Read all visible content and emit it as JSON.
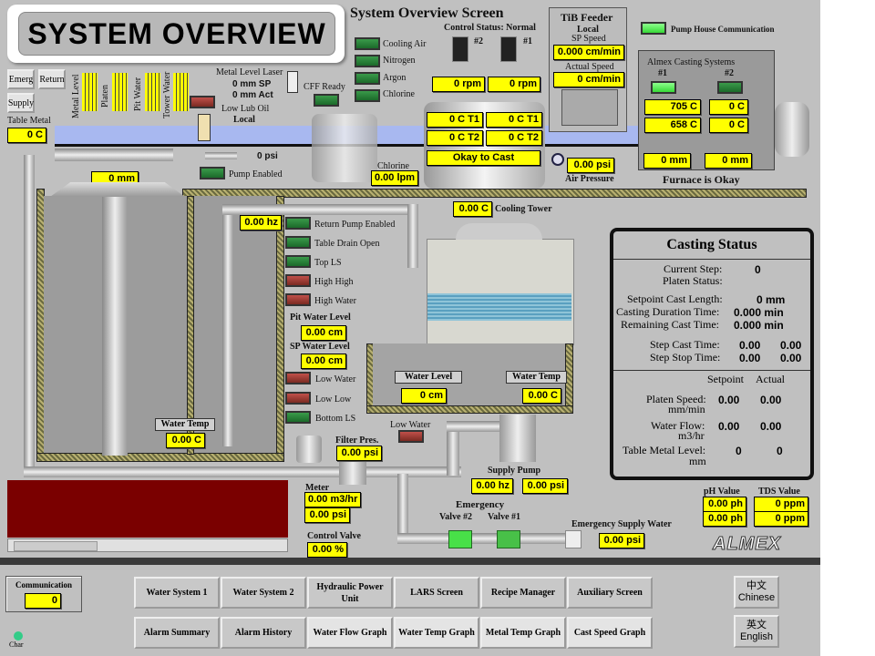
{
  "header": {
    "title": "SYSTEM OVERVIEW",
    "screen_title": "System Overview Screen",
    "control_status": "Control Status: Normal"
  },
  "left": {
    "emerg": "Emerg",
    "return": "Return",
    "supply": "Supply",
    "table_metal_label": "Table Metal",
    "table_metal": "0 C",
    "gauges": [
      "Metal Level",
      "Platen",
      "Pit Water",
      "Tower Water"
    ],
    "laser_title": "Metal Level Laser",
    "laser_sp": "0 mm SP",
    "laser_act": "0 mm Act",
    "low_lub_oil": "Low Lub Oil",
    "local": "Local",
    "psi": "0 psi",
    "pump_enabled": "Pump Enabled",
    "level_mm": "0 mm",
    "cff_ready": "CFF Ready",
    "chlorine_label": "Chlorine",
    "chlorine": "0.00 lpm"
  },
  "gases": [
    "Cooling Air",
    "Nitrogen",
    "Argon",
    "Chlorine"
  ],
  "degasser": {
    "m2": "#2",
    "m1": "#1",
    "rpm2": "0 rpm",
    "rpm1": "0 rpm",
    "t1a": "0 C T1",
    "t1b": "0 C T1",
    "t2a": "0 C T2",
    "t2b": "0 C T2",
    "okay": "Okay to Cast",
    "air_pressure": "0.00 psi",
    "air_pressure_label": "Air Pressure"
  },
  "tib": {
    "title": "TiB Feeder",
    "mode": "Local",
    "sp_label": "SP Speed",
    "sp": "0.000 cm/min",
    "act_label": "Actual Speed",
    "act": "0 cm/min"
  },
  "pump_house": "Pump House Communication",
  "furnace": {
    "title": "Almex Casting Systems",
    "n1": "#1",
    "n2": "#2",
    "t1a": "705 C",
    "t2a": "0 C",
    "t1b": "658 C",
    "t2b": "0 C",
    "mm1": "0 mm",
    "mm2": "0 mm",
    "status": "Furnace is Okay"
  },
  "pit": {
    "hz": "0.00 hz",
    "indicators": [
      "Return Pump Enabled",
      "Table Drain Open",
      "Top LS",
      "High High",
      "High Water"
    ],
    "pit_level_label": "Pit Water Level",
    "pit_level": "0.00 cm",
    "sp_level_label": "SP Water Level",
    "sp_level": "0.00 cm",
    "low_indicators": [
      "Low Water",
      "Low Low",
      "Bottom LS"
    ],
    "water_temp_label": "Water Temp",
    "water_temp": "0.00 C"
  },
  "tower": {
    "temp": "0.00 C",
    "label": "Cooling Tower",
    "water_level_label": "Water Level",
    "water_level": "0 cm",
    "water_temp_label": "Water Temp",
    "water_temp": "0.00 C"
  },
  "supply": {
    "low_water": "Low Water",
    "filter_label": "Filter Pres.",
    "filter": "0.00 psi",
    "meter_label": "Meter",
    "flow": "0.00 m3/hr",
    "meter_psi": "0.00 psi",
    "control_valve_label": "Control Valve",
    "control_valve": "0.00 %",
    "pump_label": "Supply Pump",
    "pump_hz": "0.00 hz",
    "pump_psi": "0.00 psi",
    "emergency": "Emergency",
    "valve2": "Valve #2",
    "valve1": "Valve #1",
    "emerg_supply_label": "Emergency Supply Water",
    "emerg_supply": "0.00 psi"
  },
  "casting": {
    "title": "Casting Status",
    "current_step_label": "Current Step:",
    "current_step": "0",
    "platen_status_label": "Platen Status:",
    "sp_length_label": "Setpoint Cast Length:",
    "sp_length": "0 mm",
    "duration_label": "Casting Duration Time:",
    "duration": "0.000 min",
    "remaining_label": "Remaining Cast Time:",
    "remaining": "0.000 min",
    "step_cast_label": "Step Cast Time:",
    "step_cast": [
      "0.00",
      "0.00"
    ],
    "step_stop_label": "Step Stop Time:",
    "step_stop": [
      "0.00",
      "0.00"
    ],
    "setpoint_hdr": "Setpoint",
    "actual_hdr": "Actual",
    "platen_speed_label": "Platen Speed:",
    "platen_speed_unit": "mm/min",
    "platen_speed": [
      "0.00",
      "0.00"
    ],
    "water_flow_label": "Water Flow:",
    "water_flow_unit": "m3/hr",
    "water_flow": [
      "0.00",
      "0.00"
    ],
    "table_level_label": "Table Metal Level:",
    "table_level_unit": "mm",
    "table_level": [
      "0",
      "0"
    ]
  },
  "quality": {
    "ph_label": "pH Value",
    "ph": [
      "0.00 ph",
      "0.00 ph"
    ],
    "tds_label": "TDS Value",
    "tds": [
      "0 ppm",
      "0 ppm"
    ]
  },
  "logo": "ALMEX",
  "footer": {
    "comm_label": "Communication",
    "comm": "0",
    "chart_icon": "Char",
    "row1": [
      "Water System 1",
      "Water System 2",
      "Hydraulic Power Unit",
      "LARS Screen",
      "Recipe Manager",
      "Auxiliary Screen"
    ],
    "row2": [
      "Alarm Summary",
      "Alarm History",
      "Water Flow Graph",
      "Water Temp Graph",
      "Metal Temp Graph",
      "Cast Speed Graph"
    ],
    "chinese_cn": "中文",
    "chinese": "Chinese",
    "english_cn": "英文",
    "english": "English"
  },
  "colors": {
    "value_bg": "#ffff00",
    "panel": "#c0c0c0",
    "indicator_on": "#2a8a3a",
    "alarm": "#9a3a32",
    "water": "#a8b8f0",
    "alarm_box": "#7a0000"
  }
}
